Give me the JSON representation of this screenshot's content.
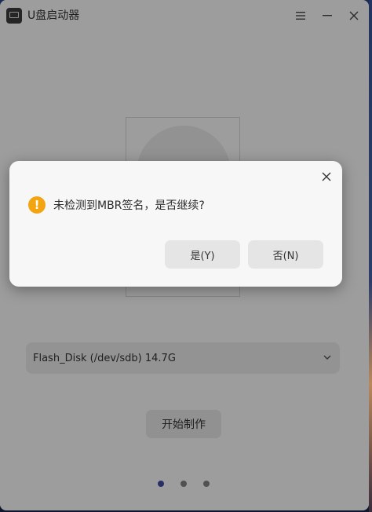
{
  "window": {
    "title": "U盘启动器"
  },
  "icons": {
    "app": "usb-drive-icon",
    "menu": "hamburger-menu-icon",
    "minimize": "minimize-icon",
    "close": "close-icon",
    "dropdown": "chevron-down-icon",
    "warning": "warning-icon"
  },
  "main": {
    "disk_select_value": "Flash_Disk (/dev/sdb) 14.7G",
    "start_button_label": "开始制作",
    "page_indicator": {
      "total": 3,
      "current": 1
    }
  },
  "dialog": {
    "warning_glyph": "!",
    "message": "未检测到MBR签名，是否继续?",
    "yes_label": "是(Y)",
    "no_label": "否(N)"
  },
  "colors": {
    "accent": "#3c4ba1",
    "warning": "#f2a511"
  }
}
